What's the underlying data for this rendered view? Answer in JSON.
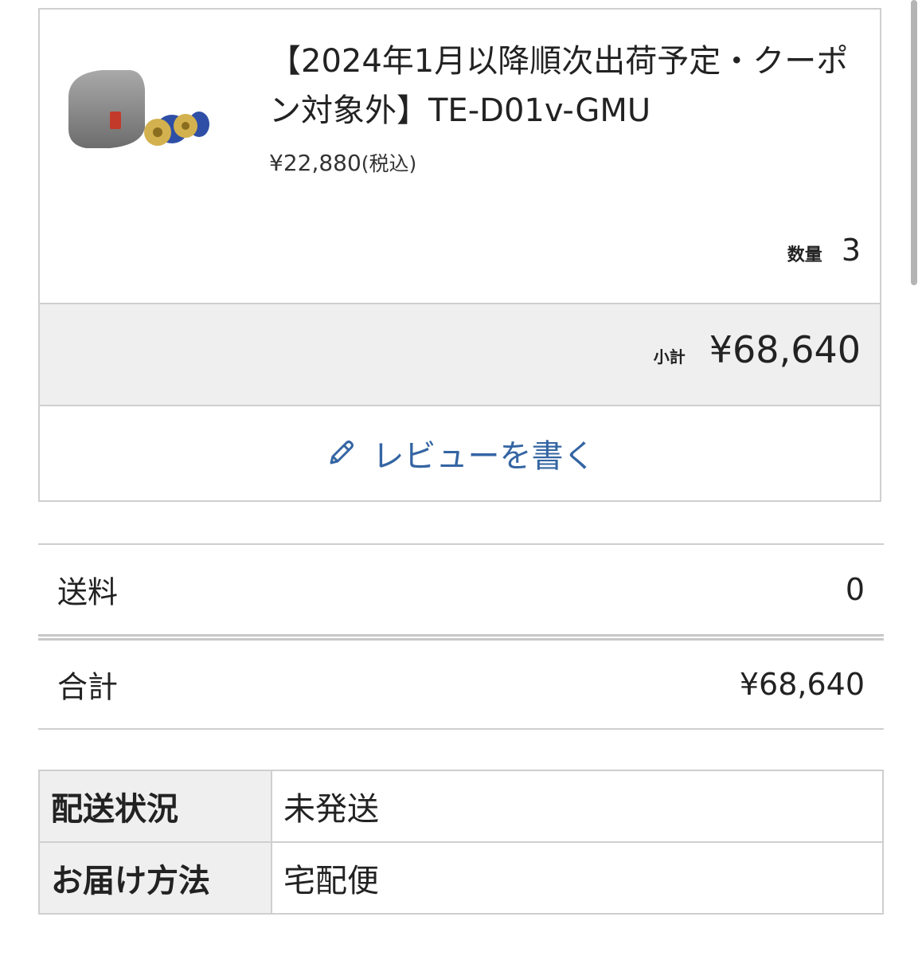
{
  "product": {
    "title": "【2024年1月以降順次出荷予定・クーポン対象外】TE-D01v-GMU",
    "unit_price": "¥22,880",
    "unit_price_suffix": "(税込)",
    "quantity_label": "数量",
    "quantity_value": "3",
    "image_icon": "earbuds-product-image"
  },
  "subtotal": {
    "label": "小計",
    "value": "¥68,640"
  },
  "review_button": {
    "label": "レビューを書く",
    "icon": "pencil-icon"
  },
  "summary": {
    "shipping_label": "送料",
    "shipping_value": "0",
    "total_label": "合計",
    "total_value": "¥68,640"
  },
  "status_table": [
    {
      "label": "配送状況",
      "value": "未発送"
    },
    {
      "label": "お届け方法",
      "value": "宅配便"
    }
  ],
  "colors": {
    "accent": "#3465a3",
    "border": "#cfcfcf",
    "header_bg": "#efefef"
  }
}
